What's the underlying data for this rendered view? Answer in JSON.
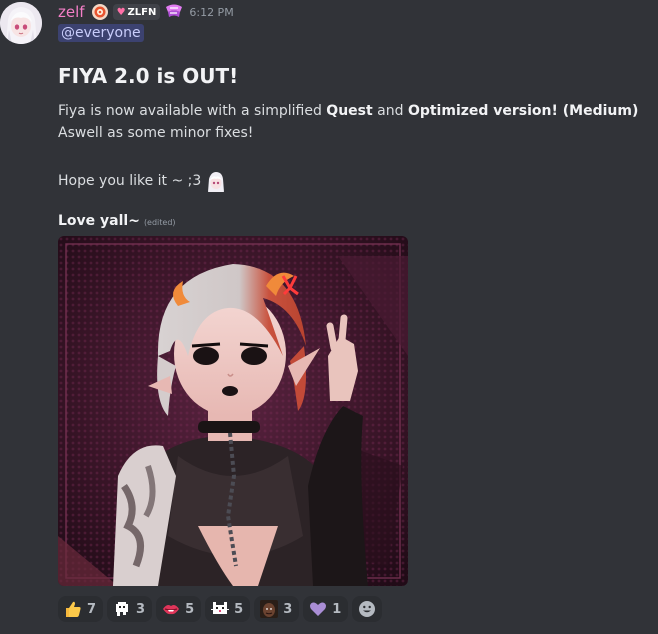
{
  "message": {
    "author": {
      "username": "zelf",
      "clan_tag": "ZLFN",
      "avatar_icon": "anime-girl-avatar-icon"
    },
    "timestamp": "6:12 PM",
    "mention": "@everyone",
    "heading": "FIYA 2.0 is OUT!",
    "body": {
      "line1_a": "Fiya is now available with a simplified ",
      "line1_b": "Quest",
      "line1_c": " and ",
      "line1_d": "Optimized version! (Medium)",
      "line2": "Aswell as some minor fixes!",
      "line3": "Hope you like it ~ ;3"
    },
    "signoff": "Love yall~",
    "edited_label": "(edited)",
    "attachment_icon": "avatar-render-image"
  },
  "reactions": [
    {
      "emoji": "thumbs-up-icon",
      "count": "7"
    },
    {
      "emoji": "pixel-ghost-icon",
      "count": "3"
    },
    {
      "emoji": "lips-icon",
      "count": "5"
    },
    {
      "emoji": "pixel-cat-icon",
      "count": "5"
    },
    {
      "emoji": "face-meme-icon",
      "count": "3"
    },
    {
      "emoji": "purple-heart-icon",
      "count": "1"
    }
  ],
  "colors": {
    "background": "#313338",
    "username": "#f47fc7",
    "mention_bg": "#3c4270",
    "reaction_bg": "#2b2d31"
  }
}
